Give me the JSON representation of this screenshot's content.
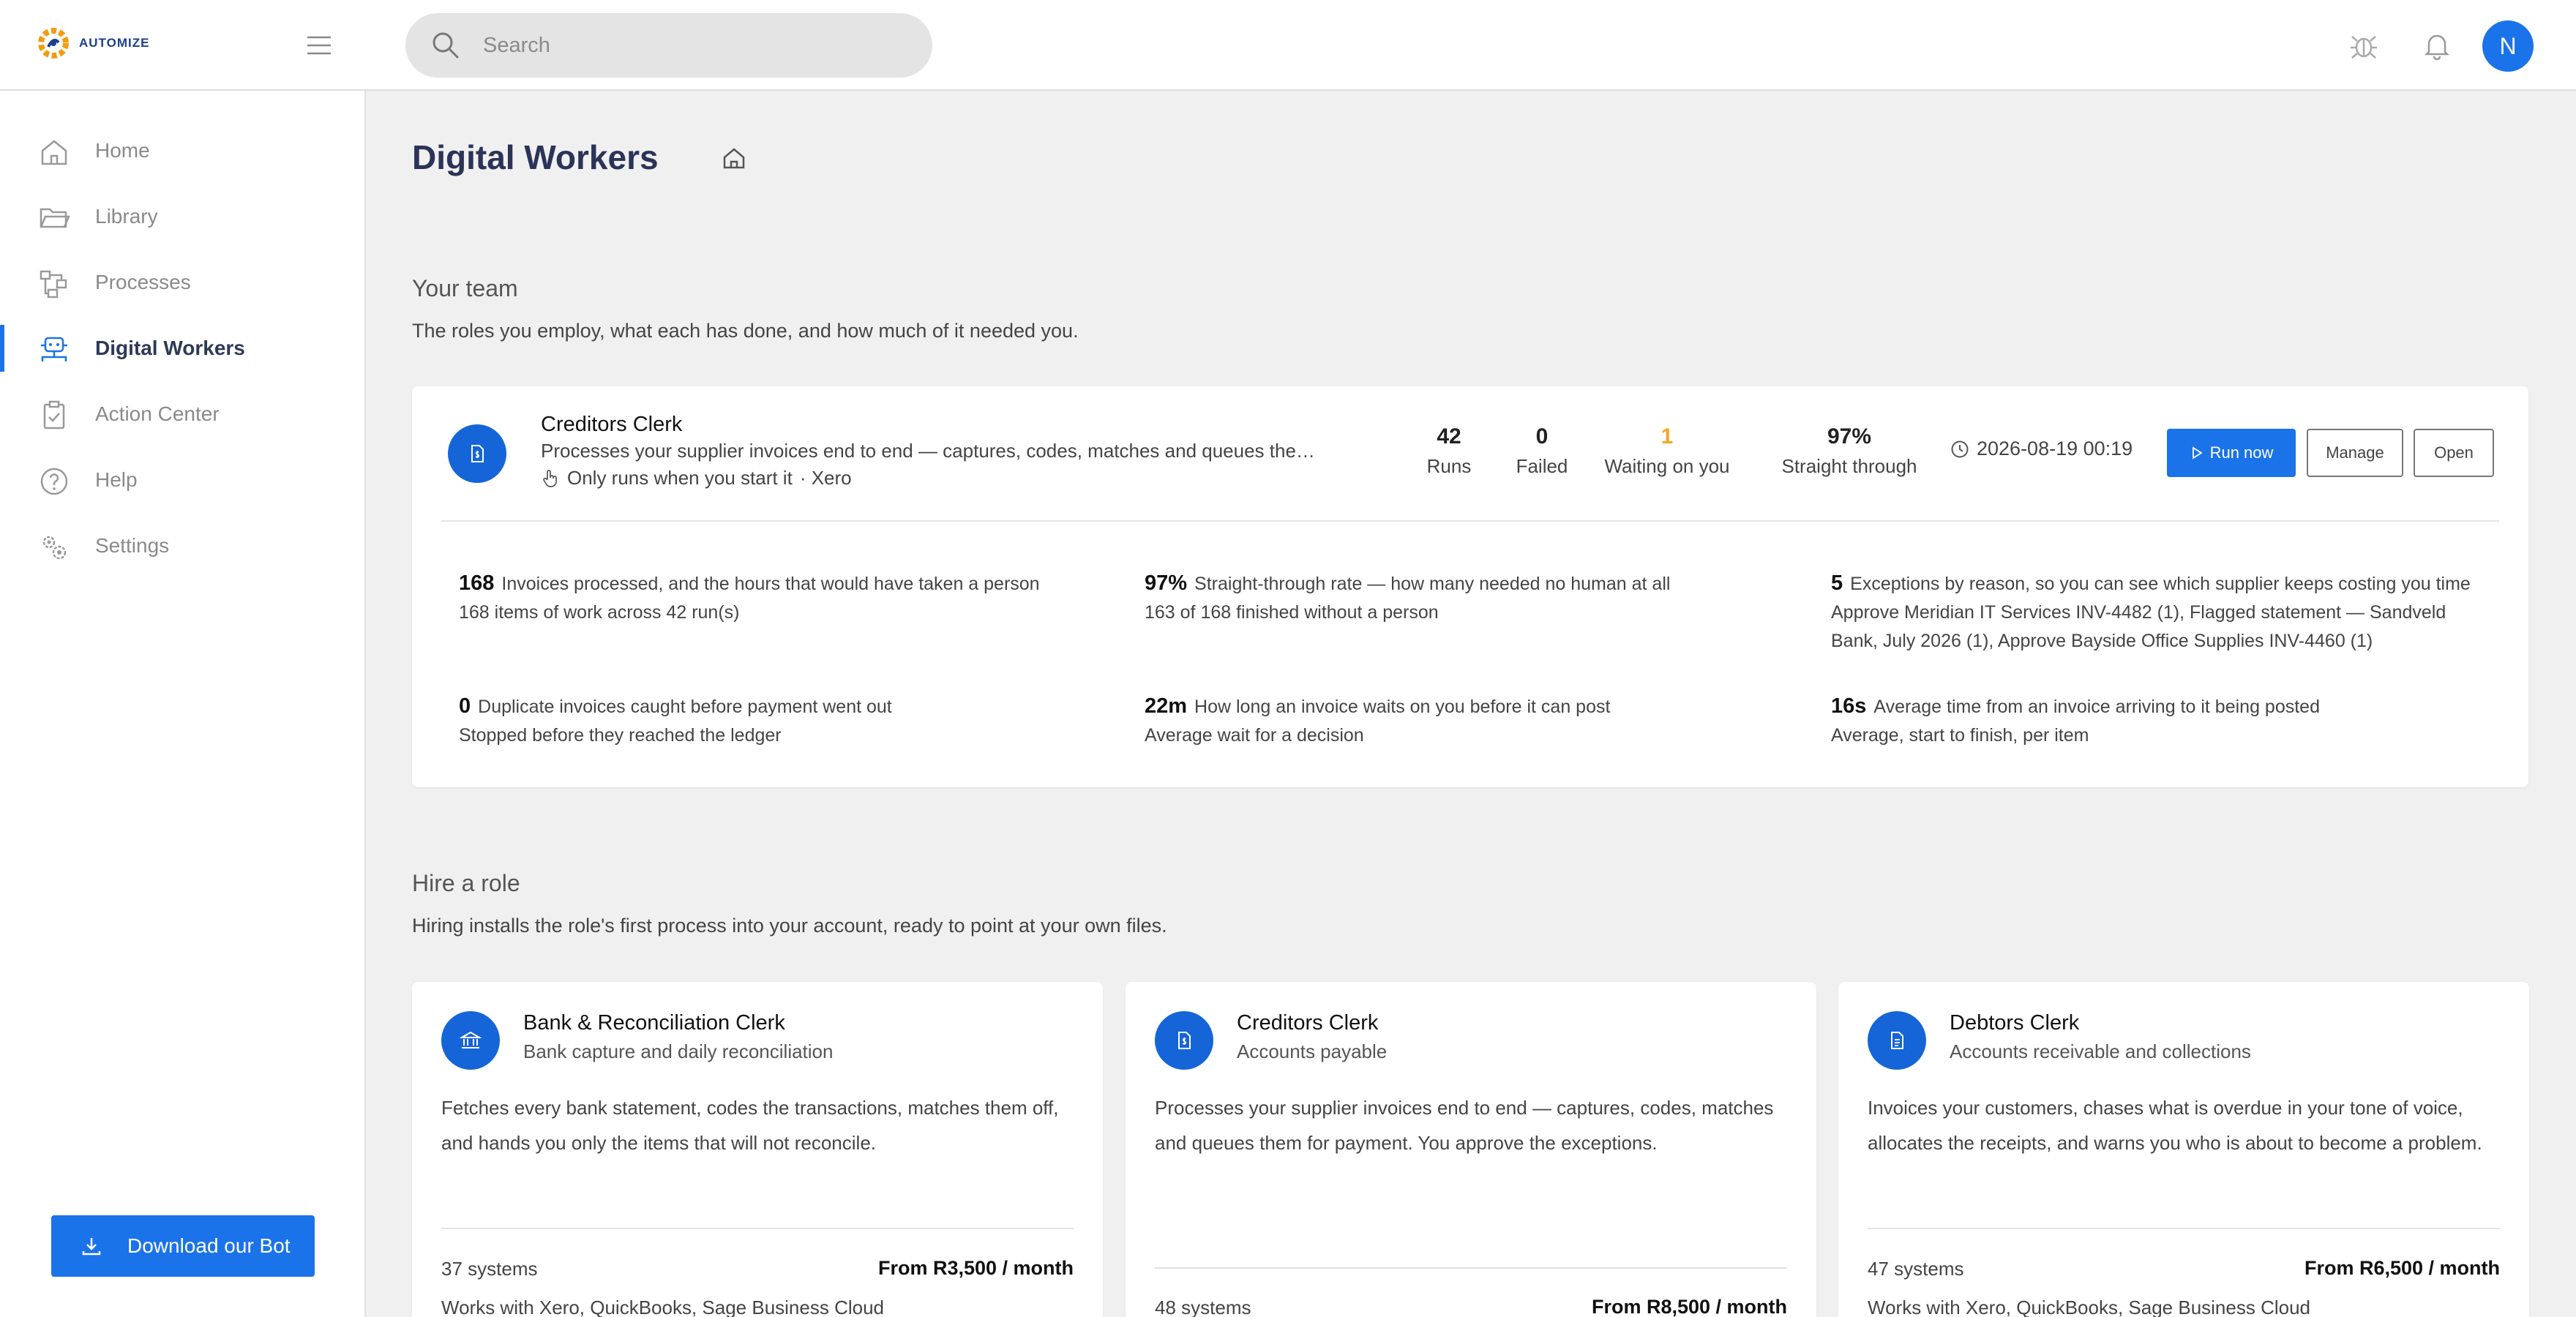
{
  "app": {
    "brand": "AUTOMIZE",
    "user_initial": "N"
  },
  "search": {
    "placeholder": "Search"
  },
  "sidebar": {
    "items": [
      {
        "label": "Home",
        "icon": "home-icon"
      },
      {
        "label": "Library",
        "icon": "folder-icon"
      },
      {
        "label": "Processes",
        "icon": "processes-icon"
      },
      {
        "label": "Digital Workers",
        "icon": "robot-icon",
        "active": true
      },
      {
        "label": "Action Center",
        "icon": "clipboard-check-icon"
      },
      {
        "label": "Help",
        "icon": "help-icon"
      },
      {
        "label": "Settings",
        "icon": "gears-icon"
      }
    ],
    "download_label": "Download our Bot"
  },
  "page": {
    "title": "Digital Workers"
  },
  "team": {
    "title": "Your team",
    "subtitle": "The roles you employ, what each has done, and how much of it needed you.",
    "worker": {
      "name": "Creditors Clerk",
      "description": "Processes your supplier invoices end to end — captures, codes, matches and queues the…",
      "trigger": "Only runs when you start it",
      "system": "· Xero",
      "stats": [
        {
          "value": "42",
          "label": "Runs"
        },
        {
          "value": "0",
          "label": "Failed"
        },
        {
          "value": "1",
          "label": "Waiting on you"
        },
        {
          "value": "97%",
          "label": "Straight through"
        }
      ],
      "last_run": "2026-08-19 00:19",
      "buttons": {
        "run": "Run now",
        "manage": "Manage",
        "open": "Open"
      },
      "metrics": [
        {
          "value": "168",
          "title": "Invoices processed, and the hours that would have taken a person",
          "sub": "168 items of work across 42 run(s)"
        },
        {
          "value": "97%",
          "title": "Straight-through rate — how many needed no human at all",
          "sub": "163 of 168 finished without a person"
        },
        {
          "value": "5",
          "title": "Exceptions by reason, so you can see which supplier keeps costing you time",
          "sub": "Approve Meridian IT Services INV-4482 (1), Flagged statement — Sandveld Bank, July 2026 (1), Approve Bayside Office Supplies INV-4460 (1)"
        },
        {
          "value": "0",
          "title": "Duplicate invoices caught before payment went out",
          "sub": "Stopped before they reached the ledger"
        },
        {
          "value": "22m",
          "title": "How long an invoice waits on you before it can post",
          "sub": "Average wait for a decision"
        },
        {
          "value": "16s",
          "title": "Average time from an invoice arriving to it being posted",
          "sub": "Average, start to finish, per item"
        }
      ]
    }
  },
  "hire": {
    "title": "Hire a role",
    "subtitle": "Hiring installs the role's first process into your account, ready to point at your own files.",
    "roles": [
      {
        "name": "Bank & Reconciliation Clerk",
        "sub": "Bank capture and daily reconciliation",
        "icon": "bank-icon",
        "description": "Fetches every bank statement, codes the transactions, matches them off, and hands you only the items that will not reconcile.",
        "systems": "37 systems",
        "price": "From R3,500 / month",
        "works": "Works with Xero, QuickBooks, Sage Business Cloud"
      },
      {
        "name": "Creditors Clerk",
        "sub": "Accounts payable",
        "icon": "invoice-icon",
        "description": "Processes your supplier invoices end to end — captures, codes, matches and queues them for payment. You approve the exceptions.",
        "systems": "48 systems",
        "price": "From R8,500 / month",
        "works": ""
      },
      {
        "name": "Debtors Clerk",
        "sub": "Accounts receivable and collections",
        "icon": "document-icon",
        "description": "Invoices your customers, chases what is overdue in your tone of voice, allocates the receipts, and warns you who is about to become a problem.",
        "systems": "47 systems",
        "price": "From R6,500 / month",
        "works": "Works with Xero, QuickBooks, Sage Business Cloud"
      }
    ]
  },
  "colors": {
    "accent": "#1a73e8",
    "badge": "#1565d8",
    "warning": "#f5a623",
    "title": "#2b3358"
  }
}
